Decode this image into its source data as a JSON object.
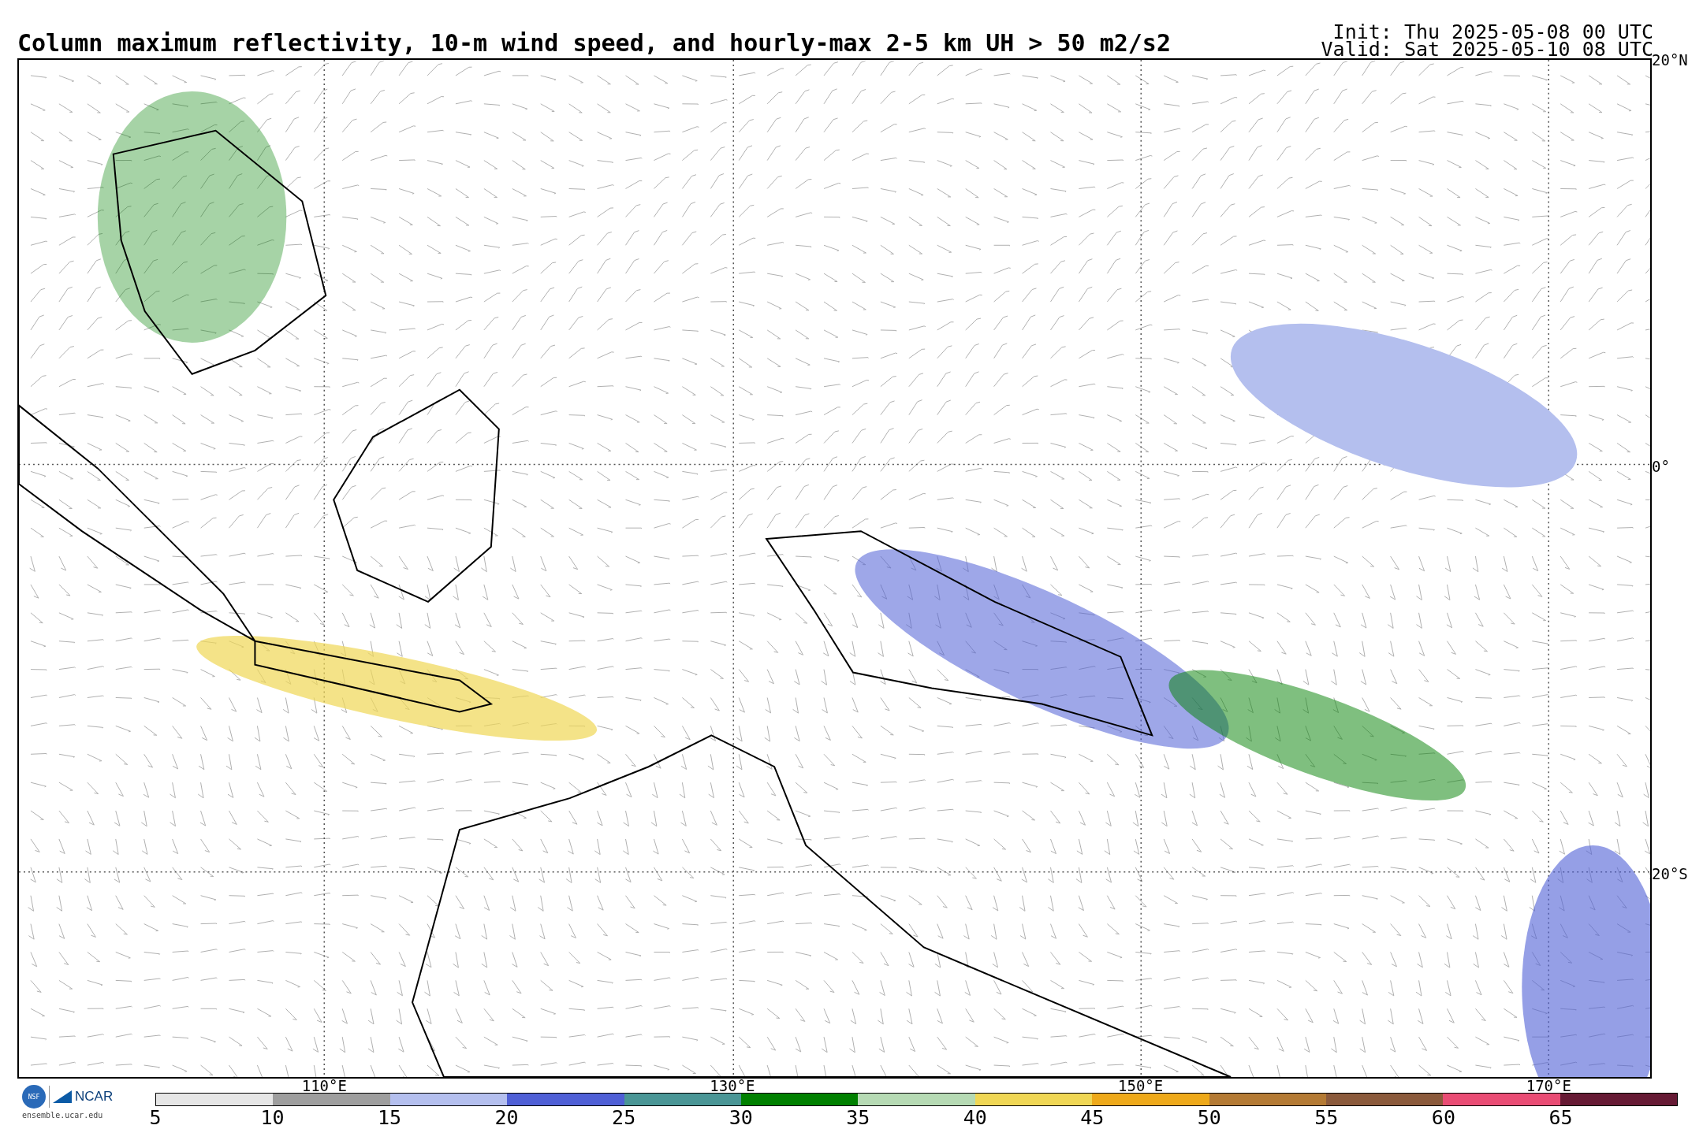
{
  "title": "Column maximum reflectivity, 10-m wind speed, and hourly-max 2-5 km UH > 50 m2/s2",
  "init": "Init: Thu 2025-05-08 00 UTC",
  "valid": "Valid: Sat 2025-05-10 08 UTC",
  "map": {
    "lat_labels": [
      "20°N",
      "0°",
      "20°S"
    ],
    "lon_labels": [
      "110°E",
      "130°E",
      "150°E",
      "170°E"
    ]
  },
  "logos": {
    "nsf": "NSF",
    "ncar": "NCAR",
    "url": "ensemble.ucar.edu"
  },
  "colorbar": {
    "ticks": [
      "5",
      "10",
      "15",
      "20",
      "25",
      "30",
      "35",
      "40",
      "45",
      "50",
      "55",
      "60",
      "65"
    ],
    "segments": [
      {
        "color": "#e6e6e6"
      },
      {
        "color": "#9e9e9e"
      },
      {
        "color": "#b4bfee"
      },
      {
        "color": "#4f5fd6"
      },
      {
        "color": "#4a9696"
      },
      {
        "color": "#008000"
      },
      {
        "color": "#b6dab4"
      },
      {
        "color": "#f0d755"
      },
      {
        "color": "#eea91a"
      },
      {
        "color": "#b47a34"
      },
      {
        "color": "#8b5a3c"
      },
      {
        "color": "#e94c74"
      },
      {
        "color": "#661a34"
      }
    ]
  }
}
